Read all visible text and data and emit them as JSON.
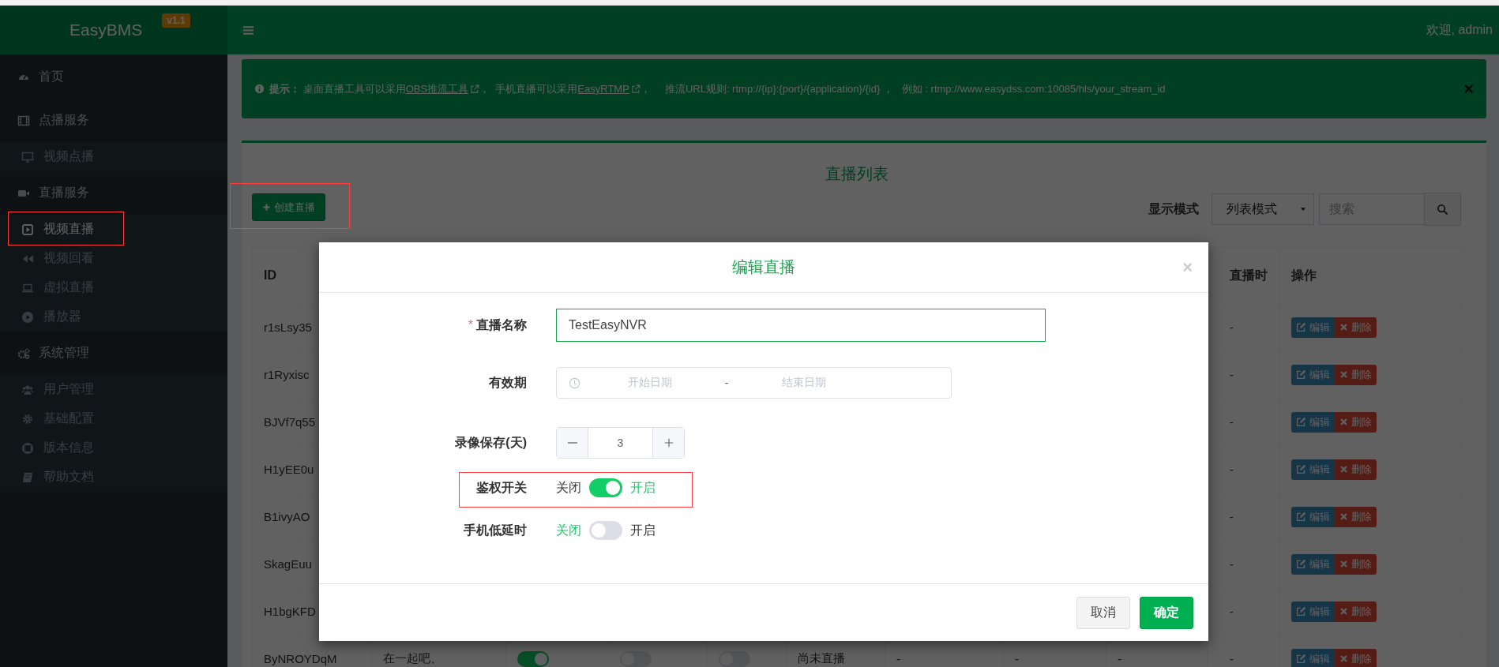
{
  "header": {
    "brand": "EasyBMS",
    "version": "v1.1",
    "welcome": "欢迎, admin"
  },
  "sidebar": {
    "items": [
      {
        "label": "首页",
        "selected": false
      },
      {
        "label": "点播服务",
        "selected": false,
        "children": [
          {
            "label": "视频点播",
            "selected": false,
            "highlighted": false
          }
        ]
      },
      {
        "label": "直播服务",
        "selected": false,
        "children": [
          {
            "label": "视频直播",
            "selected": true,
            "highlighted": true
          },
          {
            "label": "视频回看",
            "selected": false,
            "highlighted": false
          },
          {
            "label": "虚拟直播",
            "selected": false,
            "highlighted": false
          },
          {
            "label": "播放器",
            "selected": false,
            "highlighted": false
          }
        ]
      },
      {
        "label": "系统管理",
        "selected": false,
        "children": [
          {
            "label": "用户管理",
            "selected": false,
            "highlighted": false
          },
          {
            "label": "基础配置",
            "selected": false,
            "highlighted": false
          },
          {
            "label": "版本信息",
            "selected": false,
            "highlighted": false
          },
          {
            "label": "帮助文档",
            "selected": false,
            "highlighted": false
          }
        ]
      }
    ]
  },
  "alert": {
    "message": [
      {
        "kind": "bold",
        "text": "提示："
      },
      {
        "kind": "text",
        "text": " 桌面直播工具可以采用"
      },
      {
        "kind": "link",
        "text": "OBS推流工具"
      },
      {
        "kind": "text",
        "text": "，  手机直播可以采用"
      },
      {
        "kind": "link",
        "text": "EasyRTMP"
      },
      {
        "kind": "text",
        "text": "，     推流URL规则: rtmp://{ip}:{port}/{application}/{id} ，   例如 : rtmp://www.easydss.com:10085/hls/your_stream_id"
      }
    ],
    "close": "×"
  },
  "box": {
    "title": "直播列表",
    "create_button": {
      "label": "创建直播",
      "highlighted": true
    },
    "view_mode": {
      "label": "显示模式",
      "value": "列表模式"
    },
    "search": {
      "placeholder": "搜索"
    }
  },
  "table": {
    "columns": [
      "ID",
      "直播时",
      "操作"
    ],
    "rows": [
      {
        "id": "r1sLsy35",
        "duration": "-",
        "actions": [
          "编辑",
          "删除"
        ]
      },
      {
        "id": "r1Ryxisc",
        "duration": "-",
        "actions": [
          "编辑",
          "删除"
        ]
      },
      {
        "id": "BJVf7q55",
        "duration": "-",
        "actions": [
          "编辑",
          "删除"
        ]
      },
      {
        "id": "H1yEE0u",
        "duration": "-",
        "actions": [
          "编辑",
          "删除"
        ]
      },
      {
        "id": "B1ivyAO",
        "duration": "-",
        "actions": [
          "编辑",
          "删除"
        ]
      },
      {
        "id": "SkagEuu",
        "duration": "-",
        "actions": [
          "编辑",
          "删除"
        ]
      },
      {
        "id": "H1bgKFD",
        "duration": "-",
        "actions": [
          "编辑",
          "删除"
        ]
      },
      {
        "id": "ByNROYDqM",
        "name": "在一起吧、",
        "switches": [
          {
            "on": true
          },
          {
            "on": false
          },
          {
            "on": false
          }
        ],
        "status": "尚未直播",
        "values": [
          "-",
          "-",
          "-"
        ],
        "duration": "-",
        "actions": [
          "编辑",
          "删除"
        ]
      }
    ]
  },
  "modal": {
    "title": "编辑直播",
    "close": "×",
    "fields": [
      {
        "kind": "text",
        "label": "直播名称",
        "required_mark": "*",
        "value": "TestEasyNVR",
        "focused": true
      },
      {
        "kind": "daterange",
        "label": "有效期",
        "start_placeholder": "开始日期",
        "separator": "-",
        "end_placeholder": "结束日期"
      },
      {
        "kind": "stepper",
        "label": "录像保存(天)",
        "value": "3"
      },
      {
        "kind": "switch",
        "label": "鉴权开关",
        "off_label": "关闭",
        "on_label": "开启",
        "on": true,
        "highlighted": true
      },
      {
        "kind": "switch",
        "label": "手机低延时",
        "off_label": "关闭",
        "on_label": "开启",
        "on": false,
        "highlighted": false
      }
    ],
    "buttons": [
      {
        "label": "取消",
        "primary": false
      },
      {
        "label": "确定",
        "primary": true
      }
    ]
  }
}
